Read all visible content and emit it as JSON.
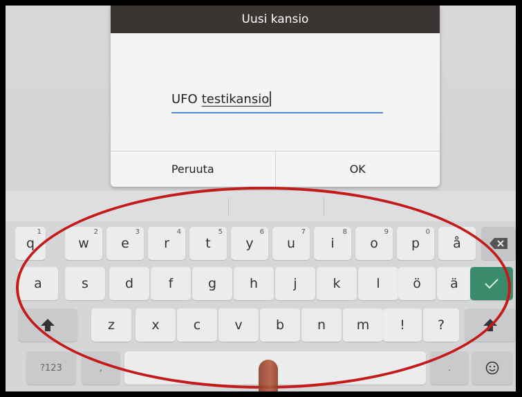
{
  "dialog": {
    "title": "Uusi kansio",
    "input_word1": "UFO",
    "input_word2": "testikansio",
    "cancel_label": "Peruuta",
    "ok_label": "OK"
  },
  "keyboard": {
    "row1": [
      {
        "label": "q",
        "hint": "1"
      },
      {
        "label": "w",
        "hint": "2"
      },
      {
        "label": "e",
        "hint": "3"
      },
      {
        "label": "r",
        "hint": "4"
      },
      {
        "label": "t",
        "hint": "5"
      },
      {
        "label": "y",
        "hint": "6"
      },
      {
        "label": "u",
        "hint": "7"
      },
      {
        "label": "i",
        "hint": "8"
      },
      {
        "label": "o",
        "hint": "9"
      },
      {
        "label": "p",
        "hint": "0"
      },
      {
        "label": "å",
        "hint": ""
      }
    ],
    "row2": [
      "a",
      "s",
      "d",
      "f",
      "g",
      "h",
      "j",
      "k",
      "l",
      "ö",
      "ä"
    ],
    "row3": [
      "z",
      "x",
      "c",
      "v",
      "b",
      "n",
      "m",
      "!",
      "?"
    ],
    "symbols_label": "?123",
    "comma_label": ",",
    "period_label": ".",
    "icons": {
      "backspace": "backspace-icon",
      "enter": "checkmark-icon",
      "shift": "shift-icon",
      "emoji": "emoji-icon"
    },
    "accent_color": "#3a8b6b"
  },
  "annotation": {
    "color": "#c41a1a"
  }
}
